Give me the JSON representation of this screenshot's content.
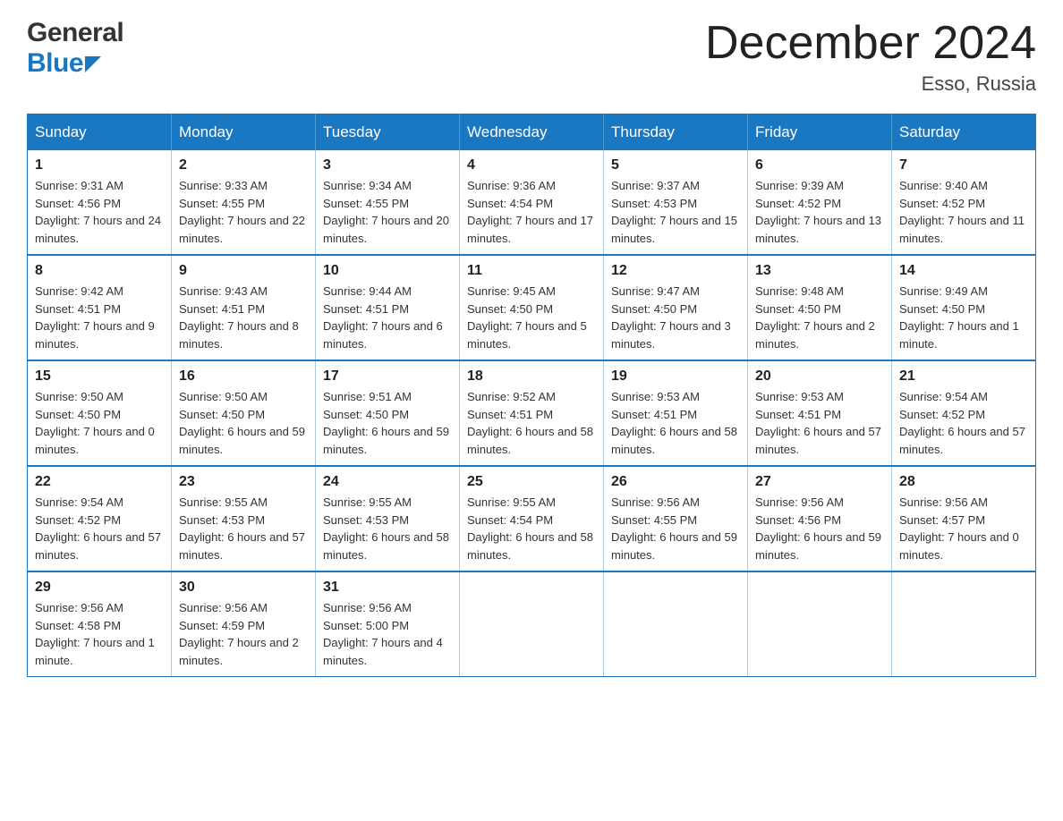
{
  "header": {
    "month_title": "December 2024",
    "location": "Esso, Russia"
  },
  "logo": {
    "general": "General",
    "blue": "Blue"
  },
  "days_of_week": [
    "Sunday",
    "Monday",
    "Tuesday",
    "Wednesday",
    "Thursday",
    "Friday",
    "Saturday"
  ],
  "weeks": [
    [
      {
        "day": "1",
        "sunrise": "Sunrise: 9:31 AM",
        "sunset": "Sunset: 4:56 PM",
        "daylight": "Daylight: 7 hours and 24 minutes."
      },
      {
        "day": "2",
        "sunrise": "Sunrise: 9:33 AM",
        "sunset": "Sunset: 4:55 PM",
        "daylight": "Daylight: 7 hours and 22 minutes."
      },
      {
        "day": "3",
        "sunrise": "Sunrise: 9:34 AM",
        "sunset": "Sunset: 4:55 PM",
        "daylight": "Daylight: 7 hours and 20 minutes."
      },
      {
        "day": "4",
        "sunrise": "Sunrise: 9:36 AM",
        "sunset": "Sunset: 4:54 PM",
        "daylight": "Daylight: 7 hours and 17 minutes."
      },
      {
        "day": "5",
        "sunrise": "Sunrise: 9:37 AM",
        "sunset": "Sunset: 4:53 PM",
        "daylight": "Daylight: 7 hours and 15 minutes."
      },
      {
        "day": "6",
        "sunrise": "Sunrise: 9:39 AM",
        "sunset": "Sunset: 4:52 PM",
        "daylight": "Daylight: 7 hours and 13 minutes."
      },
      {
        "day": "7",
        "sunrise": "Sunrise: 9:40 AM",
        "sunset": "Sunset: 4:52 PM",
        "daylight": "Daylight: 7 hours and 11 minutes."
      }
    ],
    [
      {
        "day": "8",
        "sunrise": "Sunrise: 9:42 AM",
        "sunset": "Sunset: 4:51 PM",
        "daylight": "Daylight: 7 hours and 9 minutes."
      },
      {
        "day": "9",
        "sunrise": "Sunrise: 9:43 AM",
        "sunset": "Sunset: 4:51 PM",
        "daylight": "Daylight: 7 hours and 8 minutes."
      },
      {
        "day": "10",
        "sunrise": "Sunrise: 9:44 AM",
        "sunset": "Sunset: 4:51 PM",
        "daylight": "Daylight: 7 hours and 6 minutes."
      },
      {
        "day": "11",
        "sunrise": "Sunrise: 9:45 AM",
        "sunset": "Sunset: 4:50 PM",
        "daylight": "Daylight: 7 hours and 5 minutes."
      },
      {
        "day": "12",
        "sunrise": "Sunrise: 9:47 AM",
        "sunset": "Sunset: 4:50 PM",
        "daylight": "Daylight: 7 hours and 3 minutes."
      },
      {
        "day": "13",
        "sunrise": "Sunrise: 9:48 AM",
        "sunset": "Sunset: 4:50 PM",
        "daylight": "Daylight: 7 hours and 2 minutes."
      },
      {
        "day": "14",
        "sunrise": "Sunrise: 9:49 AM",
        "sunset": "Sunset: 4:50 PM",
        "daylight": "Daylight: 7 hours and 1 minute."
      }
    ],
    [
      {
        "day": "15",
        "sunrise": "Sunrise: 9:50 AM",
        "sunset": "Sunset: 4:50 PM",
        "daylight": "Daylight: 7 hours and 0 minutes."
      },
      {
        "day": "16",
        "sunrise": "Sunrise: 9:50 AM",
        "sunset": "Sunset: 4:50 PM",
        "daylight": "Daylight: 6 hours and 59 minutes."
      },
      {
        "day": "17",
        "sunrise": "Sunrise: 9:51 AM",
        "sunset": "Sunset: 4:50 PM",
        "daylight": "Daylight: 6 hours and 59 minutes."
      },
      {
        "day": "18",
        "sunrise": "Sunrise: 9:52 AM",
        "sunset": "Sunset: 4:51 PM",
        "daylight": "Daylight: 6 hours and 58 minutes."
      },
      {
        "day": "19",
        "sunrise": "Sunrise: 9:53 AM",
        "sunset": "Sunset: 4:51 PM",
        "daylight": "Daylight: 6 hours and 58 minutes."
      },
      {
        "day": "20",
        "sunrise": "Sunrise: 9:53 AM",
        "sunset": "Sunset: 4:51 PM",
        "daylight": "Daylight: 6 hours and 57 minutes."
      },
      {
        "day": "21",
        "sunrise": "Sunrise: 9:54 AM",
        "sunset": "Sunset: 4:52 PM",
        "daylight": "Daylight: 6 hours and 57 minutes."
      }
    ],
    [
      {
        "day": "22",
        "sunrise": "Sunrise: 9:54 AM",
        "sunset": "Sunset: 4:52 PM",
        "daylight": "Daylight: 6 hours and 57 minutes."
      },
      {
        "day": "23",
        "sunrise": "Sunrise: 9:55 AM",
        "sunset": "Sunset: 4:53 PM",
        "daylight": "Daylight: 6 hours and 57 minutes."
      },
      {
        "day": "24",
        "sunrise": "Sunrise: 9:55 AM",
        "sunset": "Sunset: 4:53 PM",
        "daylight": "Daylight: 6 hours and 58 minutes."
      },
      {
        "day": "25",
        "sunrise": "Sunrise: 9:55 AM",
        "sunset": "Sunset: 4:54 PM",
        "daylight": "Daylight: 6 hours and 58 minutes."
      },
      {
        "day": "26",
        "sunrise": "Sunrise: 9:56 AM",
        "sunset": "Sunset: 4:55 PM",
        "daylight": "Daylight: 6 hours and 59 minutes."
      },
      {
        "day": "27",
        "sunrise": "Sunrise: 9:56 AM",
        "sunset": "Sunset: 4:56 PM",
        "daylight": "Daylight: 6 hours and 59 minutes."
      },
      {
        "day": "28",
        "sunrise": "Sunrise: 9:56 AM",
        "sunset": "Sunset: 4:57 PM",
        "daylight": "Daylight: 7 hours and 0 minutes."
      }
    ],
    [
      {
        "day": "29",
        "sunrise": "Sunrise: 9:56 AM",
        "sunset": "Sunset: 4:58 PM",
        "daylight": "Daylight: 7 hours and 1 minute."
      },
      {
        "day": "30",
        "sunrise": "Sunrise: 9:56 AM",
        "sunset": "Sunset: 4:59 PM",
        "daylight": "Daylight: 7 hours and 2 minutes."
      },
      {
        "day": "31",
        "sunrise": "Sunrise: 9:56 AM",
        "sunset": "Sunset: 5:00 PM",
        "daylight": "Daylight: 7 hours and 4 minutes."
      },
      null,
      null,
      null,
      null
    ]
  ]
}
